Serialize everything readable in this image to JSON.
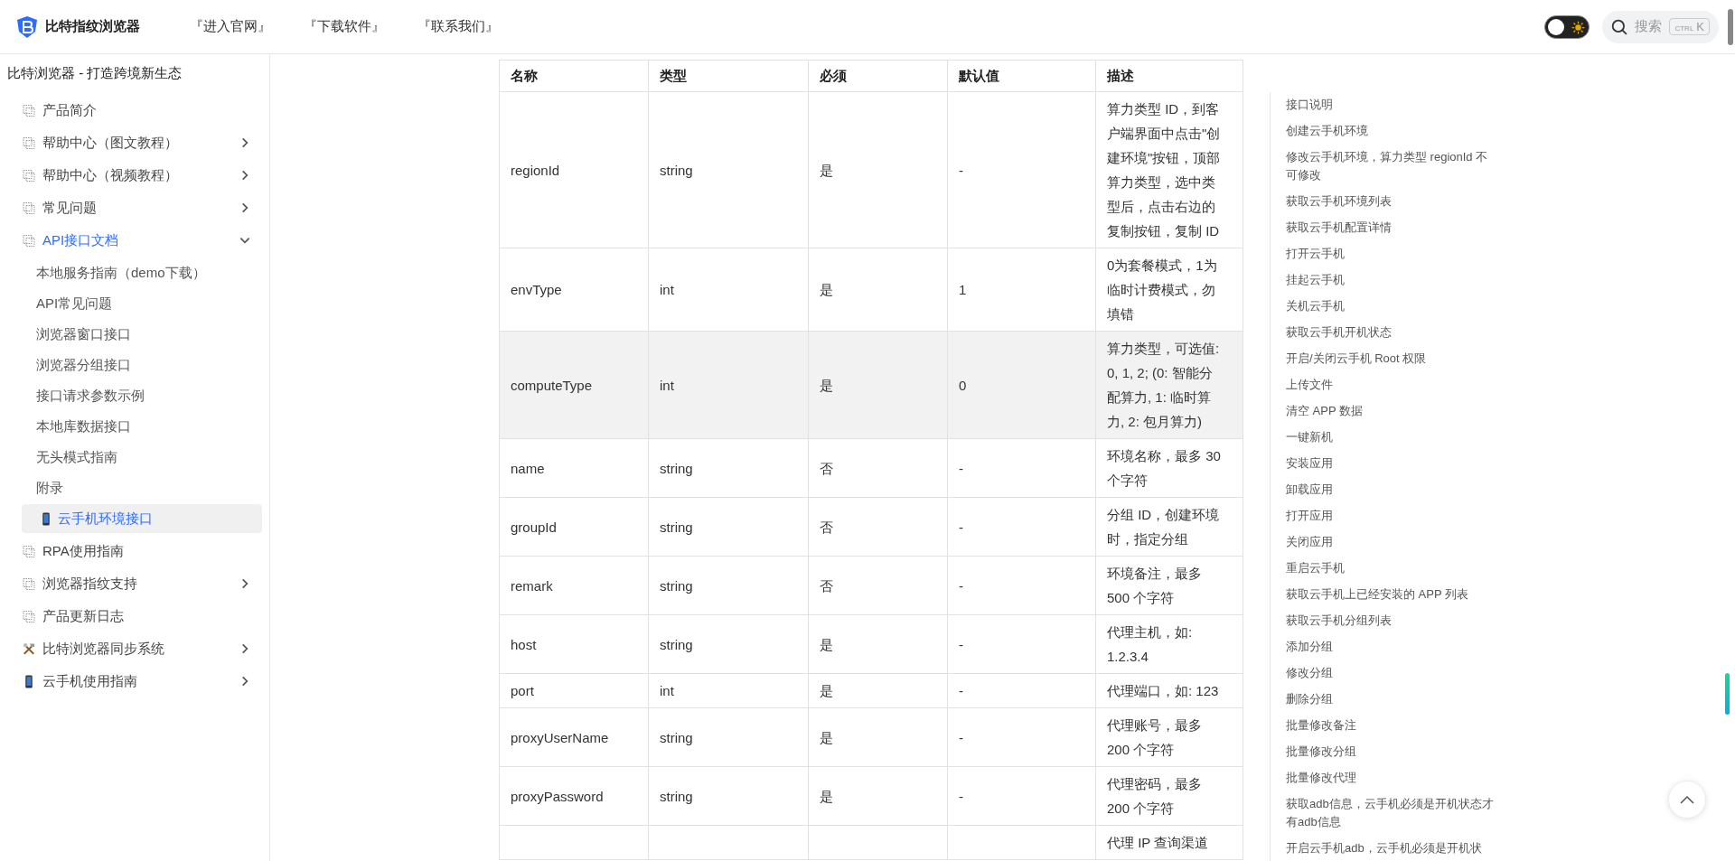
{
  "header": {
    "brand": "比特指纹浏览器",
    "nav": [
      "『进入官网』",
      "『下载软件』",
      "『联系我们』"
    ],
    "dark_mode": false,
    "search": {
      "placeholder": "搜索",
      "shortcut_keys": [
        "CTRL",
        "K"
      ]
    }
  },
  "sidebar": {
    "title": "比特浏览器 - 打造跨境新生态",
    "items": [
      {
        "label": "产品简介",
        "kind": "page",
        "expandable": false
      },
      {
        "label": "帮助中心（图文教程）",
        "kind": "page",
        "expandable": true,
        "expanded": false
      },
      {
        "label": "帮助中心（视频教程）",
        "kind": "page",
        "expandable": true,
        "expanded": false
      },
      {
        "label": "常见问题",
        "kind": "page",
        "expandable": true,
        "expanded": false
      },
      {
        "label": "API接口文档",
        "kind": "page",
        "expandable": true,
        "expanded": true,
        "children": [
          {
            "label": "本地服务指南（demo下载）",
            "kind": "text",
            "selected": false
          },
          {
            "label": "API常见问题",
            "kind": "text",
            "selected": false
          },
          {
            "label": "浏览器窗口接口",
            "kind": "text",
            "selected": false
          },
          {
            "label": "浏览器分组接口",
            "kind": "text",
            "selected": false
          },
          {
            "label": "接口请求参数示例",
            "kind": "text",
            "selected": false
          },
          {
            "label": "本地库数据接口",
            "kind": "text",
            "selected": false
          },
          {
            "label": "无头模式指南",
            "kind": "text",
            "selected": false
          },
          {
            "label": "附录",
            "kind": "text",
            "selected": false
          },
          {
            "label": "云手机环境接口",
            "kind": "phone",
            "selected": true
          }
        ]
      },
      {
        "label": "RPA使用指南",
        "kind": "page",
        "expandable": false
      },
      {
        "label": "浏览器指纹支持",
        "kind": "page",
        "expandable": true,
        "expanded": false
      },
      {
        "label": "产品更新日志",
        "kind": "page",
        "expandable": false
      },
      {
        "label": "比特浏览器同步系统",
        "kind": "tools",
        "expandable": true,
        "expanded": false
      },
      {
        "label": "云手机使用指南",
        "kind": "phone",
        "expandable": true,
        "expanded": false
      }
    ]
  },
  "table": {
    "columns": [
      "名称",
      "类型",
      "必须",
      "默认值",
      "描述"
    ],
    "rows": [
      {
        "cells": [
          "regionId",
          "string",
          "是",
          "-",
          "算力类型 ID，到客户端界面中点击\"创建环境\"按钮，顶部算力类型，选中类型后，点击右边的复制按钮，复制 ID"
        ],
        "hovered": false
      },
      {
        "cells": [
          "envType",
          "int",
          "是",
          "1",
          "0为套餐模式，1为临时计费模式，勿填错"
        ],
        "hovered": false
      },
      {
        "cells": [
          "computeType",
          "int",
          "是",
          "0",
          "算力类型，可选值: 0, 1, 2; (0: 智能分配算力, 1: 临时算力, 2: 包月算力)"
        ],
        "hovered": true
      },
      {
        "cells": [
          "name",
          "string",
          "否",
          "-",
          "环境名称，最多 30 个字符"
        ],
        "hovered": false
      },
      {
        "cells": [
          "groupId",
          "string",
          "否",
          "-",
          "分组 ID，创建环境时，指定分组"
        ],
        "hovered": false
      },
      {
        "cells": [
          "remark",
          "string",
          "否",
          "-",
          "环境备注，最多 500 个字符"
        ],
        "hovered": false
      },
      {
        "cells": [
          "host",
          "string",
          "是",
          "-",
          "代理主机，如: 1.2.3.4"
        ],
        "hovered": false
      },
      {
        "cells": [
          "port",
          "int",
          "是",
          "-",
          "代理端口，如: 123"
        ],
        "hovered": false
      },
      {
        "cells": [
          "proxyUserName",
          "string",
          "是",
          "-",
          "代理账号，最多 200 个字符"
        ],
        "hovered": false
      },
      {
        "cells": [
          "proxyPassword",
          "string",
          "是",
          "-",
          "代理密码，最多 200 个字符"
        ],
        "hovered": false
      },
      {
        "cells": [
          "",
          "",
          "",
          "",
          "代理 IP 查询渠道"
        ],
        "hovered": false
      }
    ]
  },
  "toc": {
    "items": [
      "接口说明",
      "创建云手机环境",
      "修改云手机环境，算力类型 regionId 不可修改",
      "获取云手机环境列表",
      "获取云手机配置详情",
      "打开云手机",
      "挂起云手机",
      "关机云手机",
      "获取云手机开机状态",
      "开启/关闭云手机 Root 权限",
      "上传文件",
      "清空 APP 数据",
      "一键新机",
      "安装应用",
      "卸载应用",
      "打开应用",
      "关闭应用",
      "重启云手机",
      "获取云手机上已经安装的 APP 列表",
      "获取云手机分组列表",
      "添加分组",
      "修改分组",
      "删除分组",
      "批量修改备注",
      "批量修改分组",
      "批量修改代理",
      "获取adb信息，云手机必须是开机状态才有adb信息",
      "开启云手机adb，云手机必须是开机状"
    ]
  }
}
